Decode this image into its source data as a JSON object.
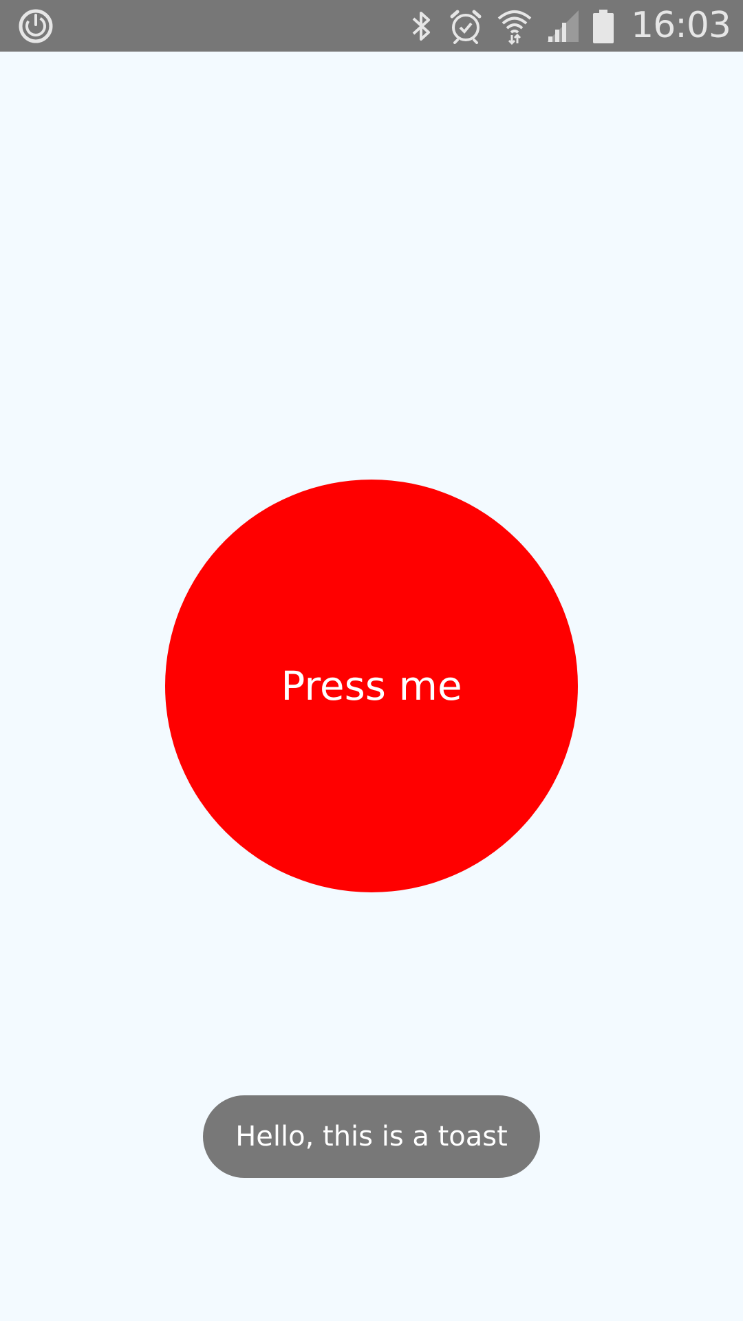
{
  "status_bar": {
    "time": "16:03",
    "background_color": "#777777",
    "icons": {
      "left": "sync-power-icon",
      "bluetooth": "bluetooth-icon",
      "alarm": "alarm-icon",
      "wifi": "wifi-icon",
      "signal": "cell-signal-icon",
      "battery": "battery-icon"
    }
  },
  "main": {
    "background_color": "#f3faff",
    "button": {
      "label": "Press me",
      "color": "#ff0000"
    },
    "toast": {
      "text": "Hello, this is a toast",
      "color": "#787878"
    }
  }
}
